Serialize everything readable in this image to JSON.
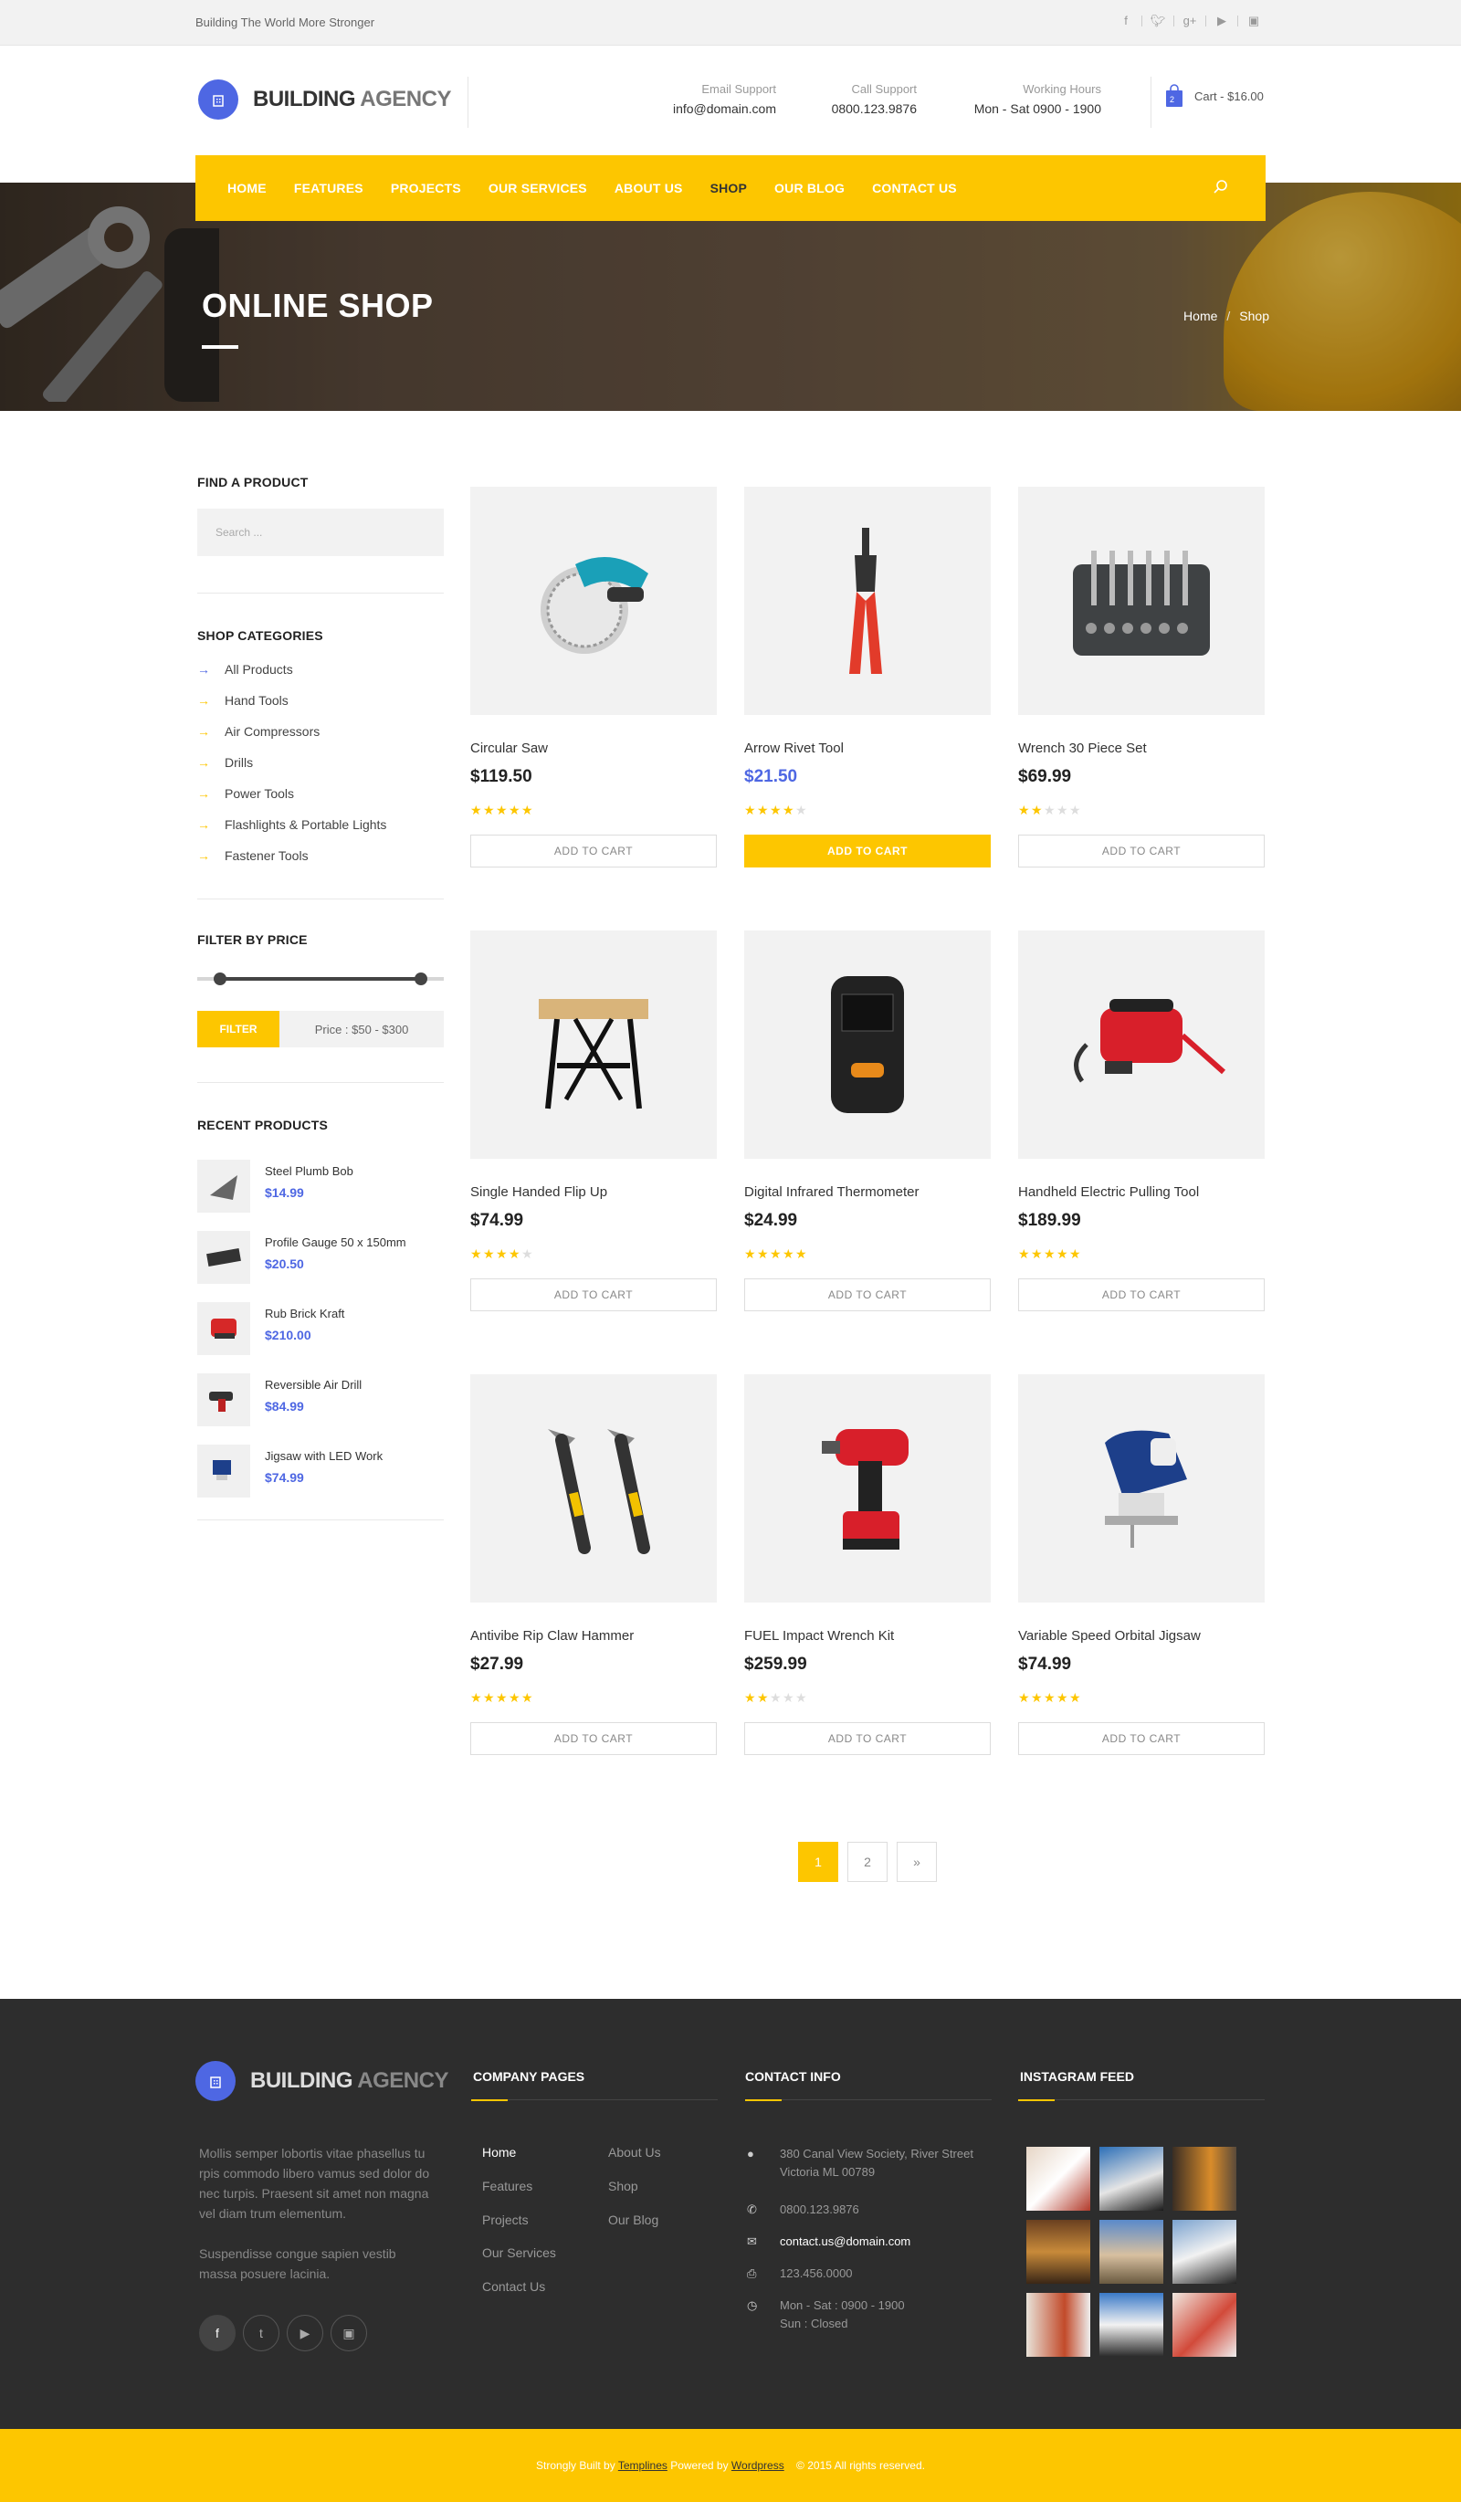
{
  "topbar": {
    "tagline": "Building The World More Stronger",
    "social": [
      "facebook-icon",
      "twitter-icon",
      "google-plus-icon",
      "youtube-icon",
      "instagram-icon"
    ]
  },
  "header": {
    "logo": {
      "bold": "BUILDING",
      "light": "AGENCY"
    },
    "email": {
      "label": "Email Support",
      "value": "info@domain.com"
    },
    "call": {
      "label": "Call Support",
      "value": "0800.123.9876"
    },
    "hours": {
      "label": "Working Hours",
      "value": "Mon - Sat 0900 - 1900"
    },
    "cart": {
      "count": "2",
      "label": "Cart - $16.00"
    }
  },
  "nav": {
    "items": [
      "HOME",
      "FEATURES",
      "PROJECTS",
      "OUR SERVICES",
      "ABOUT US",
      "SHOP",
      "OUR BLOG",
      "CONTACT US"
    ],
    "active": "SHOP"
  },
  "hero": {
    "title": "ONLINE SHOP",
    "breadcrumb": [
      "Home",
      "Shop"
    ],
    "separator": "/"
  },
  "sidebar": {
    "find": {
      "heading": "FIND A PRODUCT",
      "placeholder": "Search ..."
    },
    "categories": {
      "heading": "SHOP CATEGORIES",
      "items": [
        "All  Products",
        "Hand Tools",
        "Air Compressors",
        "Drills",
        "Power Tools",
        "Flashlights & Portable Lights",
        "Fastener Tools"
      ]
    },
    "filter": {
      "heading": "FILTER BY PRICE",
      "button": "FILTER",
      "price": "Price :  $50  -  $300"
    },
    "recent": {
      "heading": "RECENT PRODUCTS",
      "items": [
        {
          "name": "Steel Plumb Bob",
          "price": "$14.99"
        },
        {
          "name": "Profile Gauge 50 x 150mm",
          "price": "$20.50"
        },
        {
          "name": "Rub Brick Kraft",
          "price": "$210.00"
        },
        {
          "name": "Reversible Air Drill",
          "price": "$84.99"
        },
        {
          "name": "Jigsaw with LED Work",
          "price": "$74.99"
        }
      ]
    }
  },
  "products": [
    {
      "name": "Circular Saw",
      "price": "$119.50",
      "rating": 5,
      "cta": "ADD TO CART"
    },
    {
      "name": "Arrow Rivet Tool",
      "price": "$21.50",
      "rating": 4,
      "cta": "ADD TO CART"
    },
    {
      "name": "Wrench 30 Piece Set",
      "price": "$69.99",
      "rating": 2,
      "cta": "ADD TO CART"
    },
    {
      "name": "Single Handed Flip Up",
      "price": "$74.99",
      "rating": 4,
      "cta": "ADD TO CART"
    },
    {
      "name": "Digital Infrared Thermometer",
      "price": "$24.99",
      "rating": 5,
      "cta": "ADD TO CART"
    },
    {
      "name": "Handheld Electric Pulling Tool",
      "price": "$189.99",
      "rating": 5,
      "cta": "ADD TO CART"
    },
    {
      "name": "Antivibe Rip Claw Hammer",
      "price": "$27.99",
      "rating": 5,
      "cta": "ADD TO CART"
    },
    {
      "name": "FUEL Impact Wrench Kit",
      "price": "$259.99",
      "rating": 2,
      "cta": "ADD TO CART"
    },
    {
      "name": "Variable Speed Orbital Jigsaw",
      "price": "$74.99",
      "rating": 5,
      "cta": "ADD TO CART"
    }
  ],
  "pagination": {
    "pages": [
      "1",
      "2"
    ],
    "next": "»",
    "current": "1"
  },
  "footer": {
    "logo": {
      "bold": "BUILDING",
      "light": "AGENCY"
    },
    "about1": "Mollis semper lobortis vitae phasellus tu rpis commodo libero vamus sed dolor do nec turpis. Praesent sit amet non magna vel diam trum elementum.",
    "about2": "Suspendisse congue sapien vestib massa posuere lacinia.",
    "company": {
      "heading": "COMPANY PAGES",
      "col1": [
        "Home",
        "Features",
        "Projects",
        "Our Services",
        "Contact Us"
      ],
      "col2": [
        "About Us",
        "Shop",
        "Our Blog"
      ]
    },
    "contact": {
      "heading": "CONTACT INFO",
      "address1": "380 Canal View Society, River Street",
      "address2": "Victoria ML 00789",
      "phone": "0800.123.9876",
      "email": "contact.us@domain.com",
      "fax": "123.456.0000",
      "hours1": "Mon - Sat : 0900 - 1900",
      "hours2": "Sun : Closed"
    },
    "instagram": {
      "heading": "INSTAGRAM FEED"
    }
  },
  "copyright": {
    "pre": "Strongly Built by ",
    "link1": "Templines",
    "mid": " Powered by ",
    "link2": "Wordpress",
    "post": "    © 2015 All rights reserved."
  },
  "colors": {
    "accent": "#fdc600",
    "brand": "#4e67e3",
    "footer": "#2d2d2d"
  }
}
